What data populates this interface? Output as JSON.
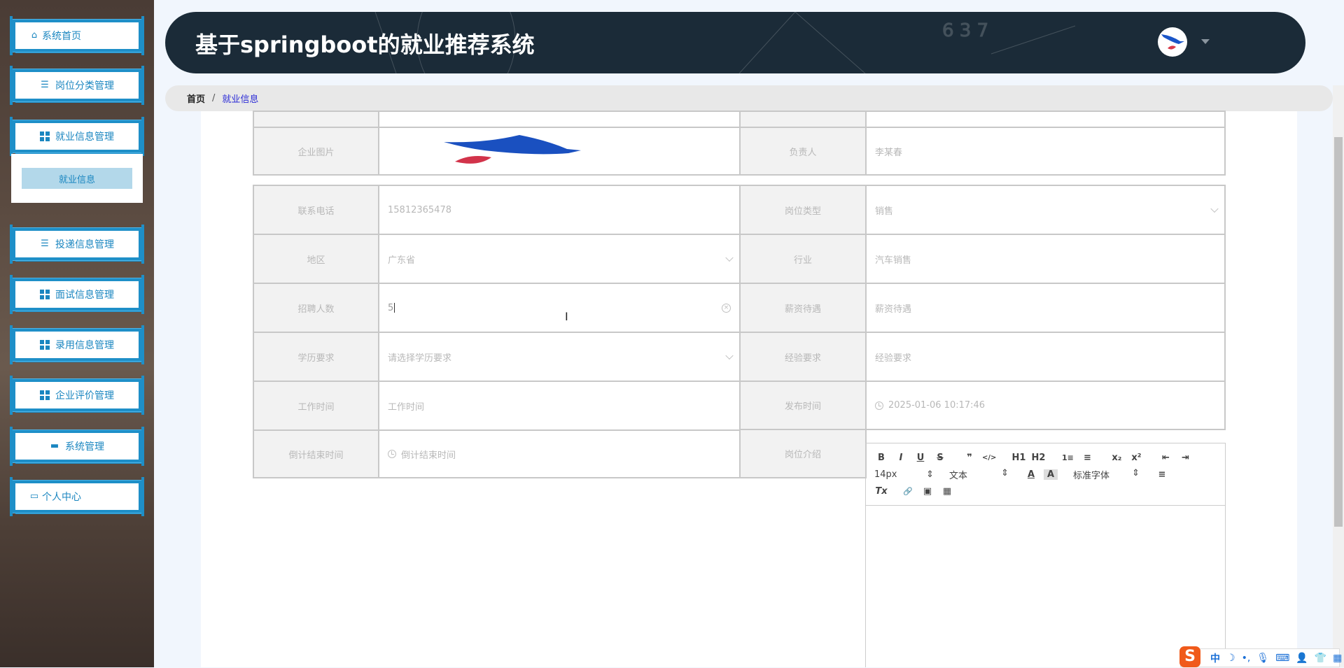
{
  "header": {
    "title": "基于springboot的就业推荐系统"
  },
  "sidebar": {
    "items": [
      {
        "label": "系统首页",
        "icon": "home-icon"
      },
      {
        "label": "岗位分类管理",
        "icon": "list-icon"
      },
      {
        "label": "就业信息管理",
        "icon": "grid-icon",
        "submenu": [
          {
            "label": "就业信息"
          }
        ]
      },
      {
        "label": "投递信息管理",
        "icon": "list-icon"
      },
      {
        "label": "面试信息管理",
        "icon": "grid-icon"
      },
      {
        "label": "录用信息管理",
        "icon": "grid-icon"
      },
      {
        "label": "企业评价管理",
        "icon": "grid-icon"
      },
      {
        "label": "系统管理",
        "icon": "chat-icon"
      },
      {
        "label": "个人中心",
        "icon": "card-icon"
      }
    ]
  },
  "breadcrumb": {
    "home": "首页",
    "sep": "/",
    "current": "就业信息"
  },
  "form": {
    "company_image": {
      "label": "企业图片"
    },
    "manager": {
      "label": "负责人",
      "value": "李某春"
    },
    "phone": {
      "label": "联系电话",
      "value": "15812365478"
    },
    "job_type": {
      "label": "岗位类型",
      "value": "销售"
    },
    "region": {
      "label": "地区",
      "value": "广东省"
    },
    "industry": {
      "label": "行业",
      "value": "汽车销售"
    },
    "headcount": {
      "label": "招聘人数",
      "value": "5"
    },
    "salary": {
      "label": "薪资待遇",
      "placeholder": "薪资待遇"
    },
    "education": {
      "label": "学历要求",
      "placeholder": "请选择学历要求"
    },
    "experience": {
      "label": "经验要求",
      "placeholder": "经验要求"
    },
    "work_time": {
      "label": "工作时间",
      "placeholder": "工作时间"
    },
    "publish_time": {
      "label": "发布时间",
      "value": "2025-01-06 10:17:46"
    },
    "countdown_end": {
      "label": "倒计结束时间",
      "placeholder": "倒计结束时间"
    },
    "job_intro": {
      "label": "岗位介绍"
    }
  },
  "editor": {
    "buttons": [
      "B",
      "I",
      "U",
      "S",
      "❞",
      "</>",
      "H1",
      "H2",
      "1≡",
      "≡",
      "x₂",
      "x²",
      "⇤",
      "⇥"
    ],
    "font_size": "14px",
    "heading": "文本",
    "font_family": "标准字体",
    "row3": [
      "Tx",
      "🔗",
      "▣",
      "▦"
    ]
  },
  "ime": {
    "mode": "中"
  }
}
